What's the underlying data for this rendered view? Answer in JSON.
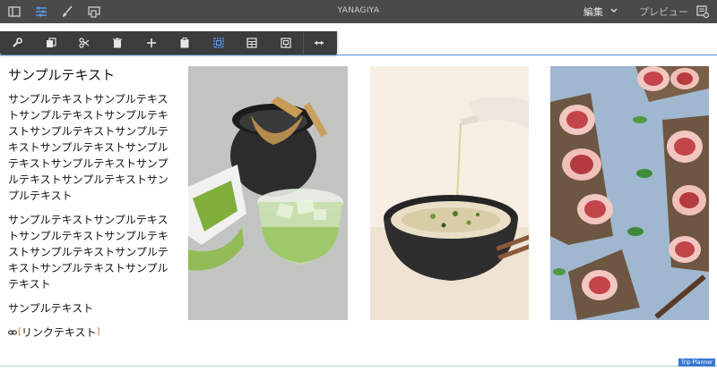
{
  "header": {
    "title": "YANAGIYA",
    "edit_label": "編集",
    "preview_label": "プレビュー"
  },
  "toolbar": {
    "buttons": [
      "configure",
      "copy",
      "cut",
      "delete",
      "insert",
      "paste",
      "group",
      "layout",
      "parent",
      "resize"
    ]
  },
  "content": {
    "heading": "サンプルテキスト",
    "paragraphs": [
      "サンプルテキストサンプルテキストサンプルテキストサンプルテキストサンプルテキストサンプルテキストサンプルテキストサンプルテキストサンプルテキストサンプルテキストサンプルテキストサンプルテキスト",
      "サンプルテキストサンプルテキストサンプルテキストサンプルテキストサンプルテキストサンプルテキストサンプルテキストサンプルテキスト",
      "サンプルテキスト"
    ],
    "link_text": "リンクテキスト"
  },
  "footer": {
    "badge": "Trip Planner"
  },
  "colors": {
    "topbar": "#4a4a4a",
    "toolbar": "#3c3c3c",
    "accent": "#4a90e2",
    "badge": "#3a78d3"
  }
}
